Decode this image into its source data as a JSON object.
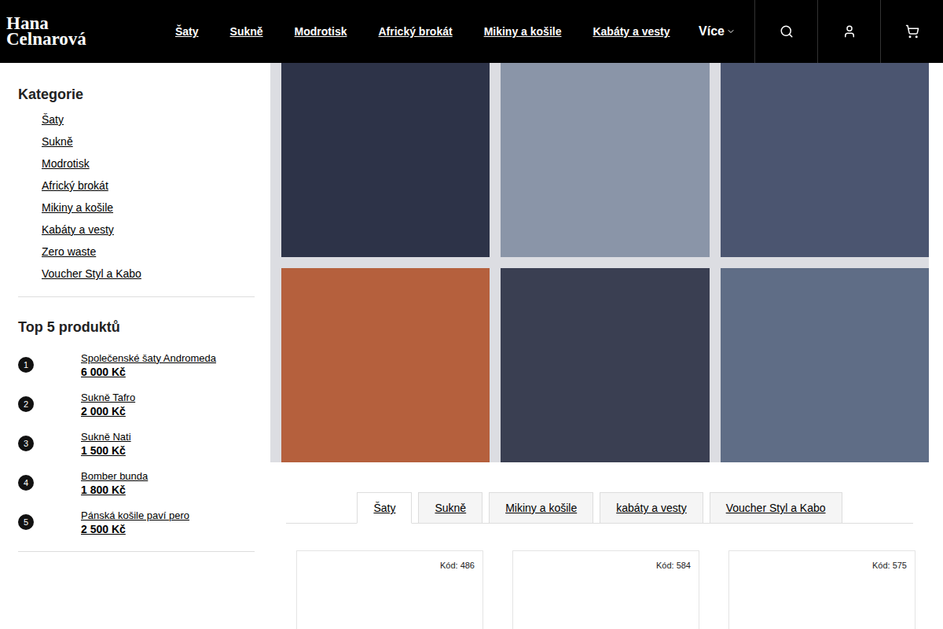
{
  "header": {
    "logo": [
      "Hana",
      "Celnarová"
    ],
    "nav": [
      "Šaty",
      "Sukně",
      "Modrotisk",
      "Africký brokát",
      "Mikiny a košile",
      "Kabáty a vesty"
    ],
    "more": "Více"
  },
  "sidebar": {
    "categories_title": "Kategorie",
    "categories": [
      "Šaty",
      "Sukně",
      "Modrotisk",
      "Africký brokát",
      "Mikiny a košile",
      "Kabáty a vesty",
      "Zero waste",
      "Voucher Styl a Kabo"
    ],
    "top_title": "Top 5 produktů",
    "top": [
      {
        "rank": "1",
        "name": "Společenské šaty Andromeda",
        "price": "6 000 Kč"
      },
      {
        "rank": "2",
        "name": "Sukně Tafro",
        "price": "2 000 Kč"
      },
      {
        "rank": "3",
        "name": "Sukně Nati",
        "price": "1 500 Kč"
      },
      {
        "rank": "4",
        "name": "Bomber bunda",
        "price": "1 800 Kč"
      },
      {
        "rank": "5",
        "name": "Pánská košile paví pero",
        "price": "2 500 Kč"
      }
    ]
  },
  "tabs": [
    {
      "label": "Šaty",
      "selected": true
    },
    {
      "label": "Sukně",
      "selected": false
    },
    {
      "label": "Mikiny a košile",
      "selected": false
    },
    {
      "label": "kabáty a vesty",
      "selected": false
    },
    {
      "label": "Voucher Styl a Kabo",
      "selected": false
    }
  ],
  "products": [
    {
      "code": "Kód: 486"
    },
    {
      "code": "Kód: 584"
    },
    {
      "code": "Kód: 575"
    }
  ]
}
